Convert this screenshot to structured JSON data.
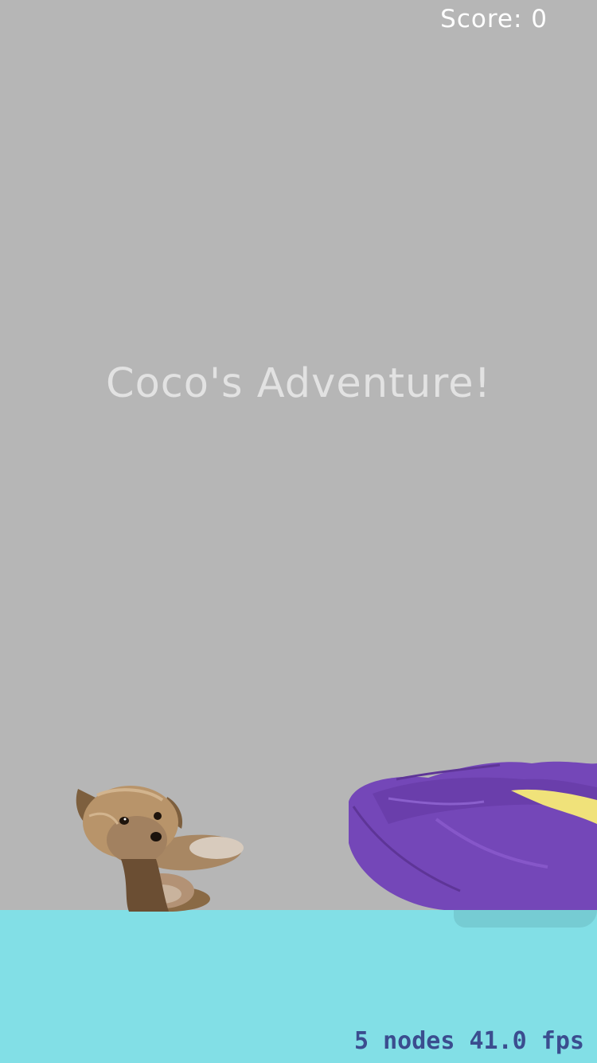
{
  "hud": {
    "score_label": "Score: 0"
  },
  "title": {
    "text": "Coco's Adventure!"
  },
  "debug": {
    "nodes": "5 nodes",
    "fps": "41.0 fps"
  },
  "sprites": {
    "player": "dog-sprite",
    "obstacle": "pet-bed-sprite"
  },
  "colors": {
    "background": "#b6b6b6",
    "ground": "#82dfe6",
    "debug_text": "#3b4d8f",
    "bed": "#7447b8",
    "bed_lining": "#f0e27a"
  }
}
